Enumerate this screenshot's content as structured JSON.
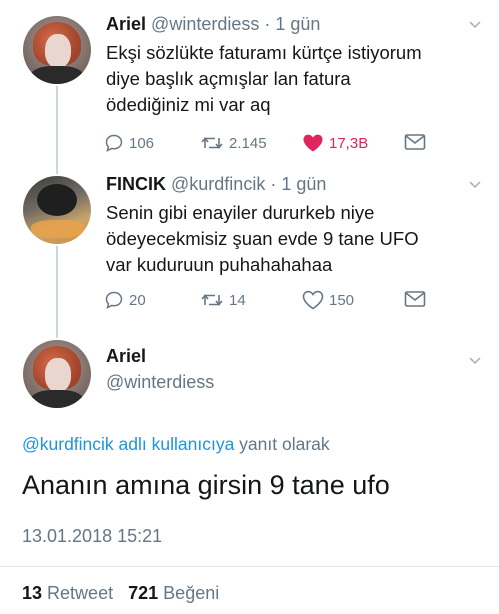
{
  "tweets": [
    {
      "name": "Ariel",
      "handle": "@winterdiess",
      "time": "· 1 gün",
      "lines": [
        "Ekşi sözlükte faturamı kürtçe istiyorum",
        "diye başlık açmışlar lan fatura",
        "ödediğiniz mi var aq"
      ],
      "replies": "106",
      "retweets": "2.145",
      "likes": "17,3B",
      "liked": true
    },
    {
      "name": "FINCIK",
      "handle": "@kurdfincik",
      "time": "· 1 gün",
      "lines": [
        "Senin gibi enayiler dururkeb niye",
        "ödeyecekmisiz şuan evde 9 tane UFO",
        "var kuduruun puhahahahaa"
      ],
      "replies": "20",
      "retweets": "14",
      "likes": "150",
      "liked": false
    }
  ],
  "focused": {
    "name": "Ariel",
    "handle": "@winterdiess",
    "reply_link": "@kurdfincik adlı kullanıcıya",
    "reply_suffix": " yanıt olarak",
    "text": "Ananın amına girsin 9 tane ufo",
    "timestamp": "13.01.2018 15:21",
    "retweet_count": "13",
    "retweet_label": "Retweet",
    "like_count": "721",
    "like_label": "Beğeni"
  },
  "colors": {
    "like": "#e0245e",
    "link": "#1b95e0",
    "muted": "#657786",
    "line": "#ccd6dd"
  }
}
